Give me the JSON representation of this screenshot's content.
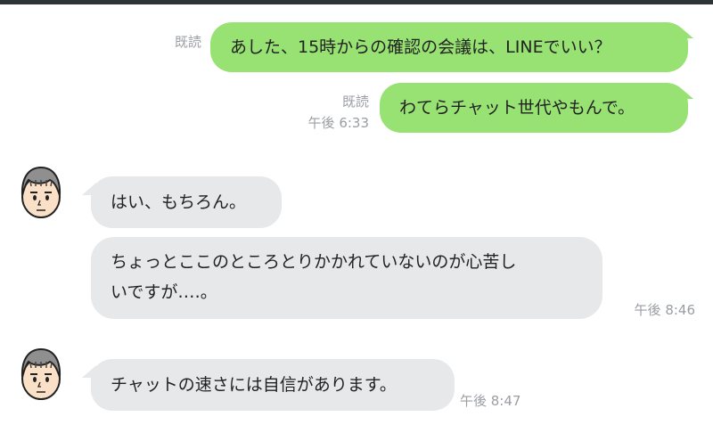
{
  "messages": [
    {
      "direction": "out",
      "read_label": "既読",
      "text": "あした、15時からの確認の会議は、LINEでいい？",
      "time": ""
    },
    {
      "direction": "out",
      "read_label": "既読",
      "text": "わてらチャット世代やもんで。",
      "time": "午後 6:33"
    },
    {
      "direction": "in",
      "lines": [
        "はい、もちろん。"
      ],
      "time": ""
    },
    {
      "direction": "in",
      "lines": [
        "ちょっとここのところとりかかれていないのが心苦し",
        "いですが‥‥。"
      ],
      "time": "午後 8:46"
    },
    {
      "direction": "in",
      "lines": [
        "チャットの速さには自信があります。"
      ],
      "time": "午後 8:47"
    }
  ],
  "colors": {
    "outgoing_bubble": "#97e273",
    "incoming_bubble": "#e6e8ea",
    "meta_text": "#9a9ea3",
    "top_bar": "#2f3437"
  },
  "icons": [
    "avatar-man-icon"
  ]
}
